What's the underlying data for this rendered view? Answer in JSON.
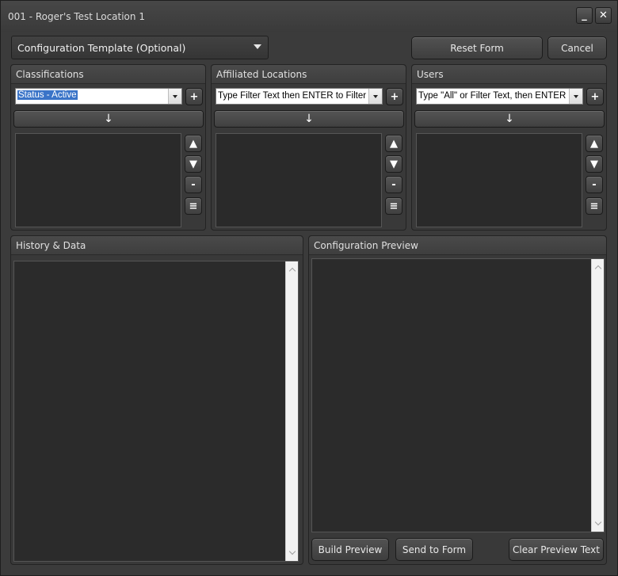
{
  "window": {
    "title": "001 - Roger's Test Location 1",
    "minimize_glyph": "_",
    "close_glyph": "✕"
  },
  "toolbar": {
    "template_label": "Configuration Template (Optional)",
    "reset_label": "Reset Form",
    "cancel_label": "Cancel"
  },
  "panels": {
    "classifications": {
      "title": "Classifications",
      "combo_value": "Status - Active"
    },
    "affiliated": {
      "title": "Affiliated Locations",
      "combo_value": "Type Filter Text then ENTER to Filter"
    },
    "users": {
      "title": "Users",
      "combo_value": "Type \"All\" or Filter Text, then ENTER"
    }
  },
  "glyphs": {
    "add": "+",
    "move_down": "↓",
    "up": "▲",
    "down": "▼",
    "remove": "-",
    "list": "≡"
  },
  "history": {
    "title": "History & Data"
  },
  "preview": {
    "title": "Configuration Preview",
    "build_label": "Build Preview",
    "send_label": "Send to Form",
    "clear_label": "Clear Preview Text"
  },
  "icons": [
    "minimize-icon",
    "close-icon",
    "chevron-down-icon",
    "plus-icon",
    "arrow-down-icon",
    "triangle-up-icon",
    "triangle-down-icon",
    "minus-icon",
    "list-icon"
  ]
}
